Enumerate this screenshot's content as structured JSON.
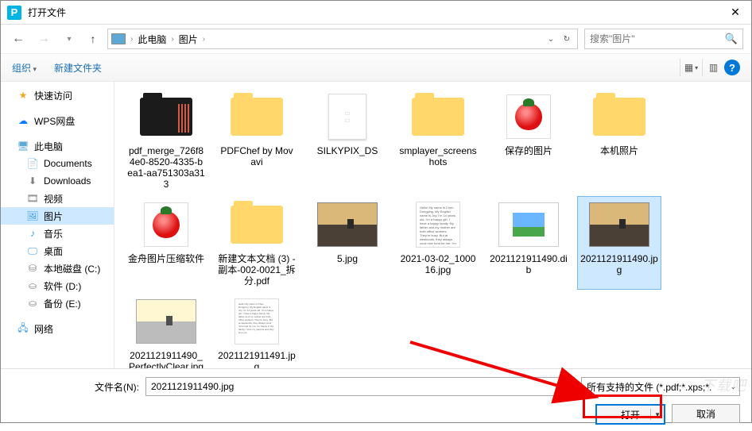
{
  "window": {
    "title": "打开文件"
  },
  "nav": {
    "crumbs": [
      "此电脑",
      "图片"
    ],
    "search_placeholder": "搜索\"图片\""
  },
  "toolbar": {
    "organize": "组织",
    "new_folder": "新建文件夹"
  },
  "sidebar": {
    "quick": "快速访问",
    "wps": "WPS网盘",
    "pc": "此电脑",
    "pc_children": [
      {
        "label": "Documents",
        "icon": "doc"
      },
      {
        "label": "Downloads",
        "icon": "down"
      },
      {
        "label": "视频",
        "icon": "video"
      },
      {
        "label": "图片",
        "icon": "pic",
        "selected": true
      },
      {
        "label": "音乐",
        "icon": "music"
      },
      {
        "label": "桌面",
        "icon": "desk"
      },
      {
        "label": "本地磁盘 (C:)",
        "icon": "disk-c"
      },
      {
        "label": "软件 (D:)",
        "icon": "disk"
      },
      {
        "label": "备份 (E:)",
        "icon": "disk"
      }
    ],
    "network": "网络"
  },
  "files": {
    "row1": [
      {
        "name": "pdf_merge_726f84e0-8520-4335-bea1-aa75130­3a313",
        "type": "folder-dark"
      },
      {
        "name": "PDFChef by Movavi",
        "type": "folder"
      },
      {
        "name": "SILKYPIX_DS",
        "type": "paper"
      },
      {
        "name": "smplayer_screenshots",
        "type": "folder"
      },
      {
        "name": "保存的图片",
        "type": "strawberry"
      },
      {
        "name": "本机照片",
        "type": "folder"
      },
      {
        "name": "金舟图片压缩软件",
        "type": "strawberry"
      }
    ],
    "row2": [
      {
        "name": "新建文本文档 (3) - 副本-002-0021_拆分.pdf",
        "type": "folder"
      },
      {
        "name": "5.jpg",
        "type": "photo"
      },
      {
        "name": "2021-03-02_100016.jpg",
        "type": "text"
      },
      {
        "name": "2021121911490.dib",
        "type": "img-frame"
      },
      {
        "name": "2021121911490.jpg",
        "type": "photo",
        "selected": true
      },
      {
        "name": "2021121911490_PerfectlyClear.jpg",
        "type": "photo-misty"
      },
      {
        "name": "2021121911491.jpg",
        "type": "text-small"
      }
    ]
  },
  "footer": {
    "filename_label": "文件名(N):",
    "filename_value": "2021121911490.jpg",
    "filter_label": "所有支持的文件 (*.pdf;*.xps;*.",
    "open": "打开",
    "cancel": "取消"
  },
  "sample_text": "Hello! My name is Chen Dongying. My English name is Joy. I'm 14 years old. I'm a happy girl. I have a happy family. My father and my mother are both office workers. They're busy. But at weekends, they always cook nice food for me. I'm happy in the family. I love my parents and they love me."
}
